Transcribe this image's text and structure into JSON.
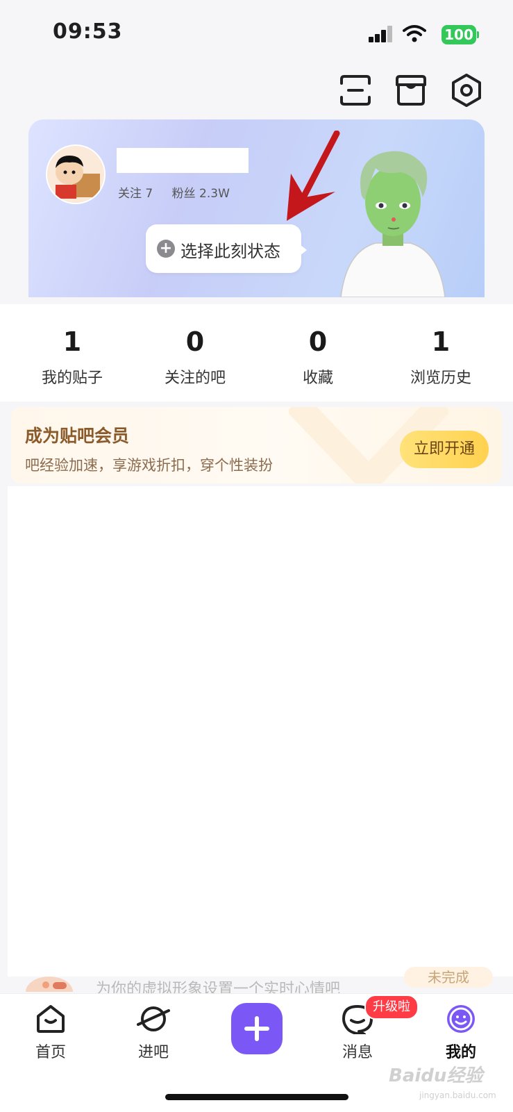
{
  "status_bar": {
    "time": "09:53",
    "battery": "100"
  },
  "profile": {
    "following": "关注 7",
    "fans": "粉丝 2.3W",
    "status_prompt": "选择此刻状态"
  },
  "stats": [
    {
      "value": "1",
      "label": "我的贴子"
    },
    {
      "value": "0",
      "label": "关注的吧"
    },
    {
      "value": "0",
      "label": "收藏"
    },
    {
      "value": "1",
      "label": "浏览历史"
    }
  ],
  "vip": {
    "title": "成为贴吧会员",
    "subtitle": "吧经验加速，享游戏折扣，穿个性装扮",
    "button": "立即开通"
  },
  "peek": {
    "text": "为你的虚拟形象设置一个实时心情吧",
    "button": "未完成"
  },
  "tabs": [
    {
      "label": "首页"
    },
    {
      "label": "进吧"
    },
    {
      "label": "消息",
      "badge": "升级啦"
    },
    {
      "label": "我的"
    }
  ],
  "watermark": {
    "brand": "Baidu经验",
    "url": "jingyan.baidu.com"
  },
  "colors": {
    "accent": "#7b57f5",
    "badge": "#ff3b46",
    "vip_button": "#ffd24f",
    "battery": "#34c759"
  }
}
